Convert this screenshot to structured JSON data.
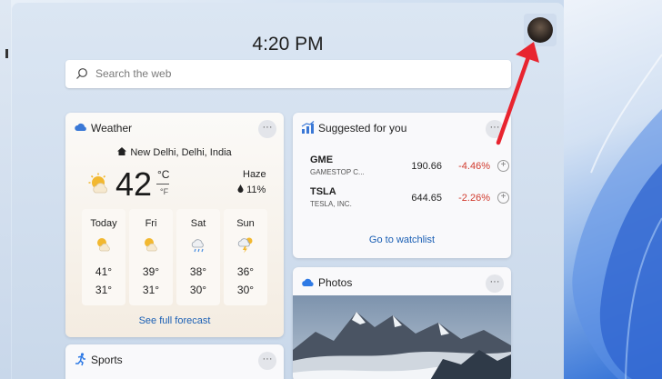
{
  "clock": "4:20 PM",
  "search": {
    "placeholder": "Search the web"
  },
  "weather": {
    "title": "Weather",
    "location": "New Delhi, Delhi, India",
    "temperature": "42",
    "unit_c": "°C",
    "unit_f": "°F",
    "condition": "Haze",
    "humidity": "11%",
    "forecast": [
      {
        "day": "Today",
        "high": "41°",
        "low": "31°",
        "icon": "partly-sunny-icon"
      },
      {
        "day": "Fri",
        "high": "39°",
        "low": "31°",
        "icon": "partly-sunny-icon"
      },
      {
        "day": "Sat",
        "high": "38°",
        "low": "30°",
        "icon": "rain-cloud-icon"
      },
      {
        "day": "Sun",
        "high": "36°",
        "low": "30°",
        "icon": "thunderstorm-icon"
      }
    ],
    "link": "See full forecast"
  },
  "stocks": {
    "title": "Suggested for you",
    "items": [
      {
        "symbol": "GME",
        "name": "GAMESTOP C...",
        "price": "190.66",
        "change": "-4.46%"
      },
      {
        "symbol": "TSLA",
        "name": "TESLA, INC.",
        "price": "644.65",
        "change": "-2.26%"
      }
    ],
    "link": "Go to watchlist"
  },
  "photos": {
    "title": "Photos"
  },
  "sports": {
    "title": "Sports"
  },
  "more": "···",
  "add": "+",
  "colors": {
    "negative": "#d13b2e",
    "link": "#1a5fb4",
    "accent": "#2f6fd6",
    "arrow": "#e8242f"
  }
}
